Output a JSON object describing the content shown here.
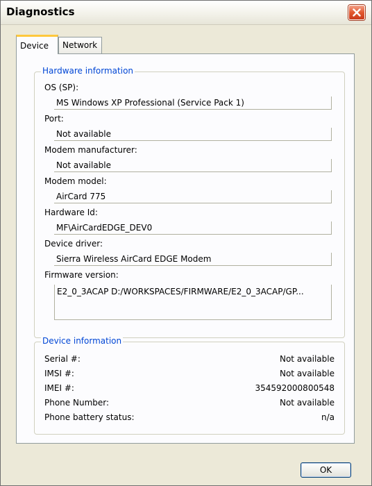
{
  "window": {
    "title": "Diagnostics",
    "close_icon": "close-icon"
  },
  "tabs": [
    {
      "label": "Device",
      "active": true
    },
    {
      "label": "Network",
      "active": false
    }
  ],
  "hardware": {
    "title": "Hardware information",
    "fields": [
      {
        "label": "OS (SP):",
        "value": "MS Windows XP Professional (Service Pack 1)"
      },
      {
        "label": "Port:",
        "value": "Not available"
      },
      {
        "label": "Modem manufacturer:",
        "value": "Not available"
      },
      {
        "label": "Modem model:",
        "value": "AirCard 775"
      },
      {
        "label": "Hardware Id:",
        "value": "MF\\AirCardEDGE_DEV0"
      },
      {
        "label": "Device driver:",
        "value": "Sierra Wireless AirCard EDGE Modem"
      },
      {
        "label": "Firmware version:",
        "value": "E2_0_3ACAP D:/WORKSPACES/FIRMWARE/E2_0_3ACAP/GP..."
      }
    ]
  },
  "device": {
    "title": "Device information",
    "rows": [
      {
        "label": "Serial #:",
        "value": "Not available"
      },
      {
        "label": "IMSI #:",
        "value": "Not available"
      },
      {
        "label": "IMEI #:",
        "value": "354592000800548"
      },
      {
        "label": "Phone Number:",
        "value": "Not available"
      },
      {
        "label": "Phone battery status:",
        "value": "n/a"
      }
    ]
  },
  "buttons": {
    "ok": "OK"
  },
  "colors": {
    "group_title": "#0046d5",
    "close_button": "#e2572e",
    "active_tab_accent": "#ffc83c"
  }
}
